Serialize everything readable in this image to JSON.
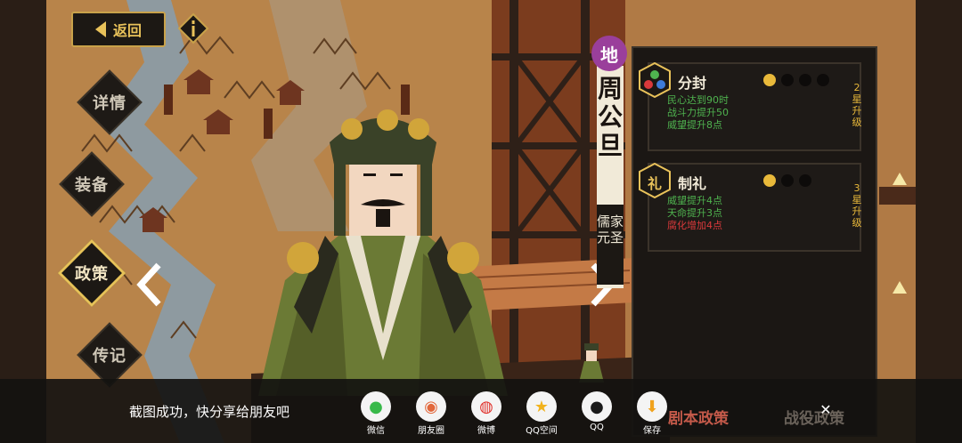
{
  "header": {
    "back_label": "返回",
    "info_icon": "info-icon"
  },
  "side_menu": [
    {
      "label": "详情",
      "active": false
    },
    {
      "label": "装备",
      "active": false
    },
    {
      "label": "政策",
      "active": true
    },
    {
      "label": "传记",
      "active": false
    }
  ],
  "character": {
    "tier_seal": "地",
    "name": "周公旦",
    "title": "儒家元圣"
  },
  "policies": [
    {
      "name": "分封",
      "icon": "three-orbs-icon",
      "level_dots": [
        true,
        false,
        false,
        false
      ],
      "effects": [
        {
          "text": "民心达到90时",
          "color": "#4fb34f"
        },
        {
          "text": "战斗力提升50",
          "color": "#4fb34f"
        },
        {
          "text": "威望提升8点",
          "color": "#4fb34f"
        }
      ],
      "upgrade": "2星升级"
    },
    {
      "name": "制礼",
      "icon": "li-ritual-icon",
      "icon_char": "礼",
      "level_dots": [
        true,
        false,
        false
      ],
      "effects": [
        {
          "text": "威望提升4点",
          "color": "#4fb34f"
        },
        {
          "text": "天命提升3点",
          "color": "#4fb34f"
        },
        {
          "text": "腐化增加4点",
          "color": "#d9393b"
        }
      ],
      "upgrade": "3星升级"
    }
  ],
  "tabs": {
    "left": "剧本政策",
    "right": "战役政策"
  },
  "share": {
    "prompt": "截图成功，快分享给朋友吧",
    "targets": [
      {
        "label": "微信",
        "icon": "wechat-icon",
        "glyph": "●",
        "color": "#38b94a"
      },
      {
        "label": "朋友圈",
        "icon": "moments-icon",
        "glyph": "◉",
        "color": "#e2683c"
      },
      {
        "label": "微博",
        "icon": "weibo-icon",
        "glyph": "◍",
        "color": "#e0322c"
      },
      {
        "label": "QQ空间",
        "icon": "qzone-icon",
        "glyph": "★",
        "color": "#f1b21c"
      },
      {
        "label": "QQ",
        "icon": "qq-icon",
        "glyph": "●",
        "color": "#1a1a1a"
      },
      {
        "label": "保存",
        "icon": "save-icon",
        "glyph": "⬇",
        "color": "#f0a21c"
      }
    ]
  },
  "colors": {
    "gold": "#e9c25a",
    "seal_purple": "#9a3f9b"
  }
}
